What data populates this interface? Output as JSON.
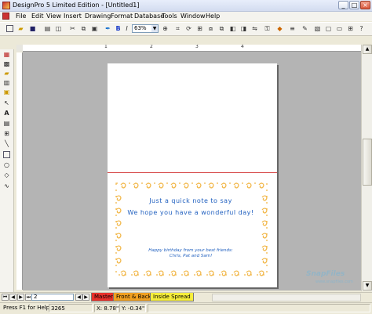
{
  "window": {
    "title": "DesignPro 5  Limited Edition - [Untitled1]",
    "minimize": "_",
    "maximize": "□",
    "close": "×"
  },
  "menu": [
    "File",
    "Edit",
    "View",
    "Insert",
    "Drawing",
    "Format",
    "Database",
    "Tools",
    "Window",
    "Help"
  ],
  "toolbar": {
    "zoom_value": "63%",
    "bold": "B",
    "italic": "I",
    "underline": "U"
  },
  "ruler": {
    "marks": [
      "1",
      "2",
      "3",
      "4"
    ]
  },
  "card": {
    "greeting_line1": "Just a quick note to say",
    "greeting_line2": "We hope you have a wonderful day!",
    "message_line1": "Happy birthday from your best friends:",
    "message_line2": "Chris, Pat and Sam!",
    "text_color": "#1f5fbf",
    "border_color": "#f2b84b",
    "fold_line_color": "#d64545"
  },
  "tabs": {
    "page_number": "2",
    "items": [
      {
        "label": "Master",
        "color": "#e8312a"
      },
      {
        "label": "Front & Back",
        "color": "#f0a020"
      },
      {
        "label": "Inside Spread",
        "color": "#f6ee3a"
      }
    ]
  },
  "status": {
    "help_text": "Press F1 for Help",
    "object_id": "3265",
    "x_coord": "X: 8.78\"",
    "y_coord": "Y: -0.34\""
  },
  "watermark": {
    "brand": "SnapFiles",
    "url": "www.snapfiles.com"
  }
}
